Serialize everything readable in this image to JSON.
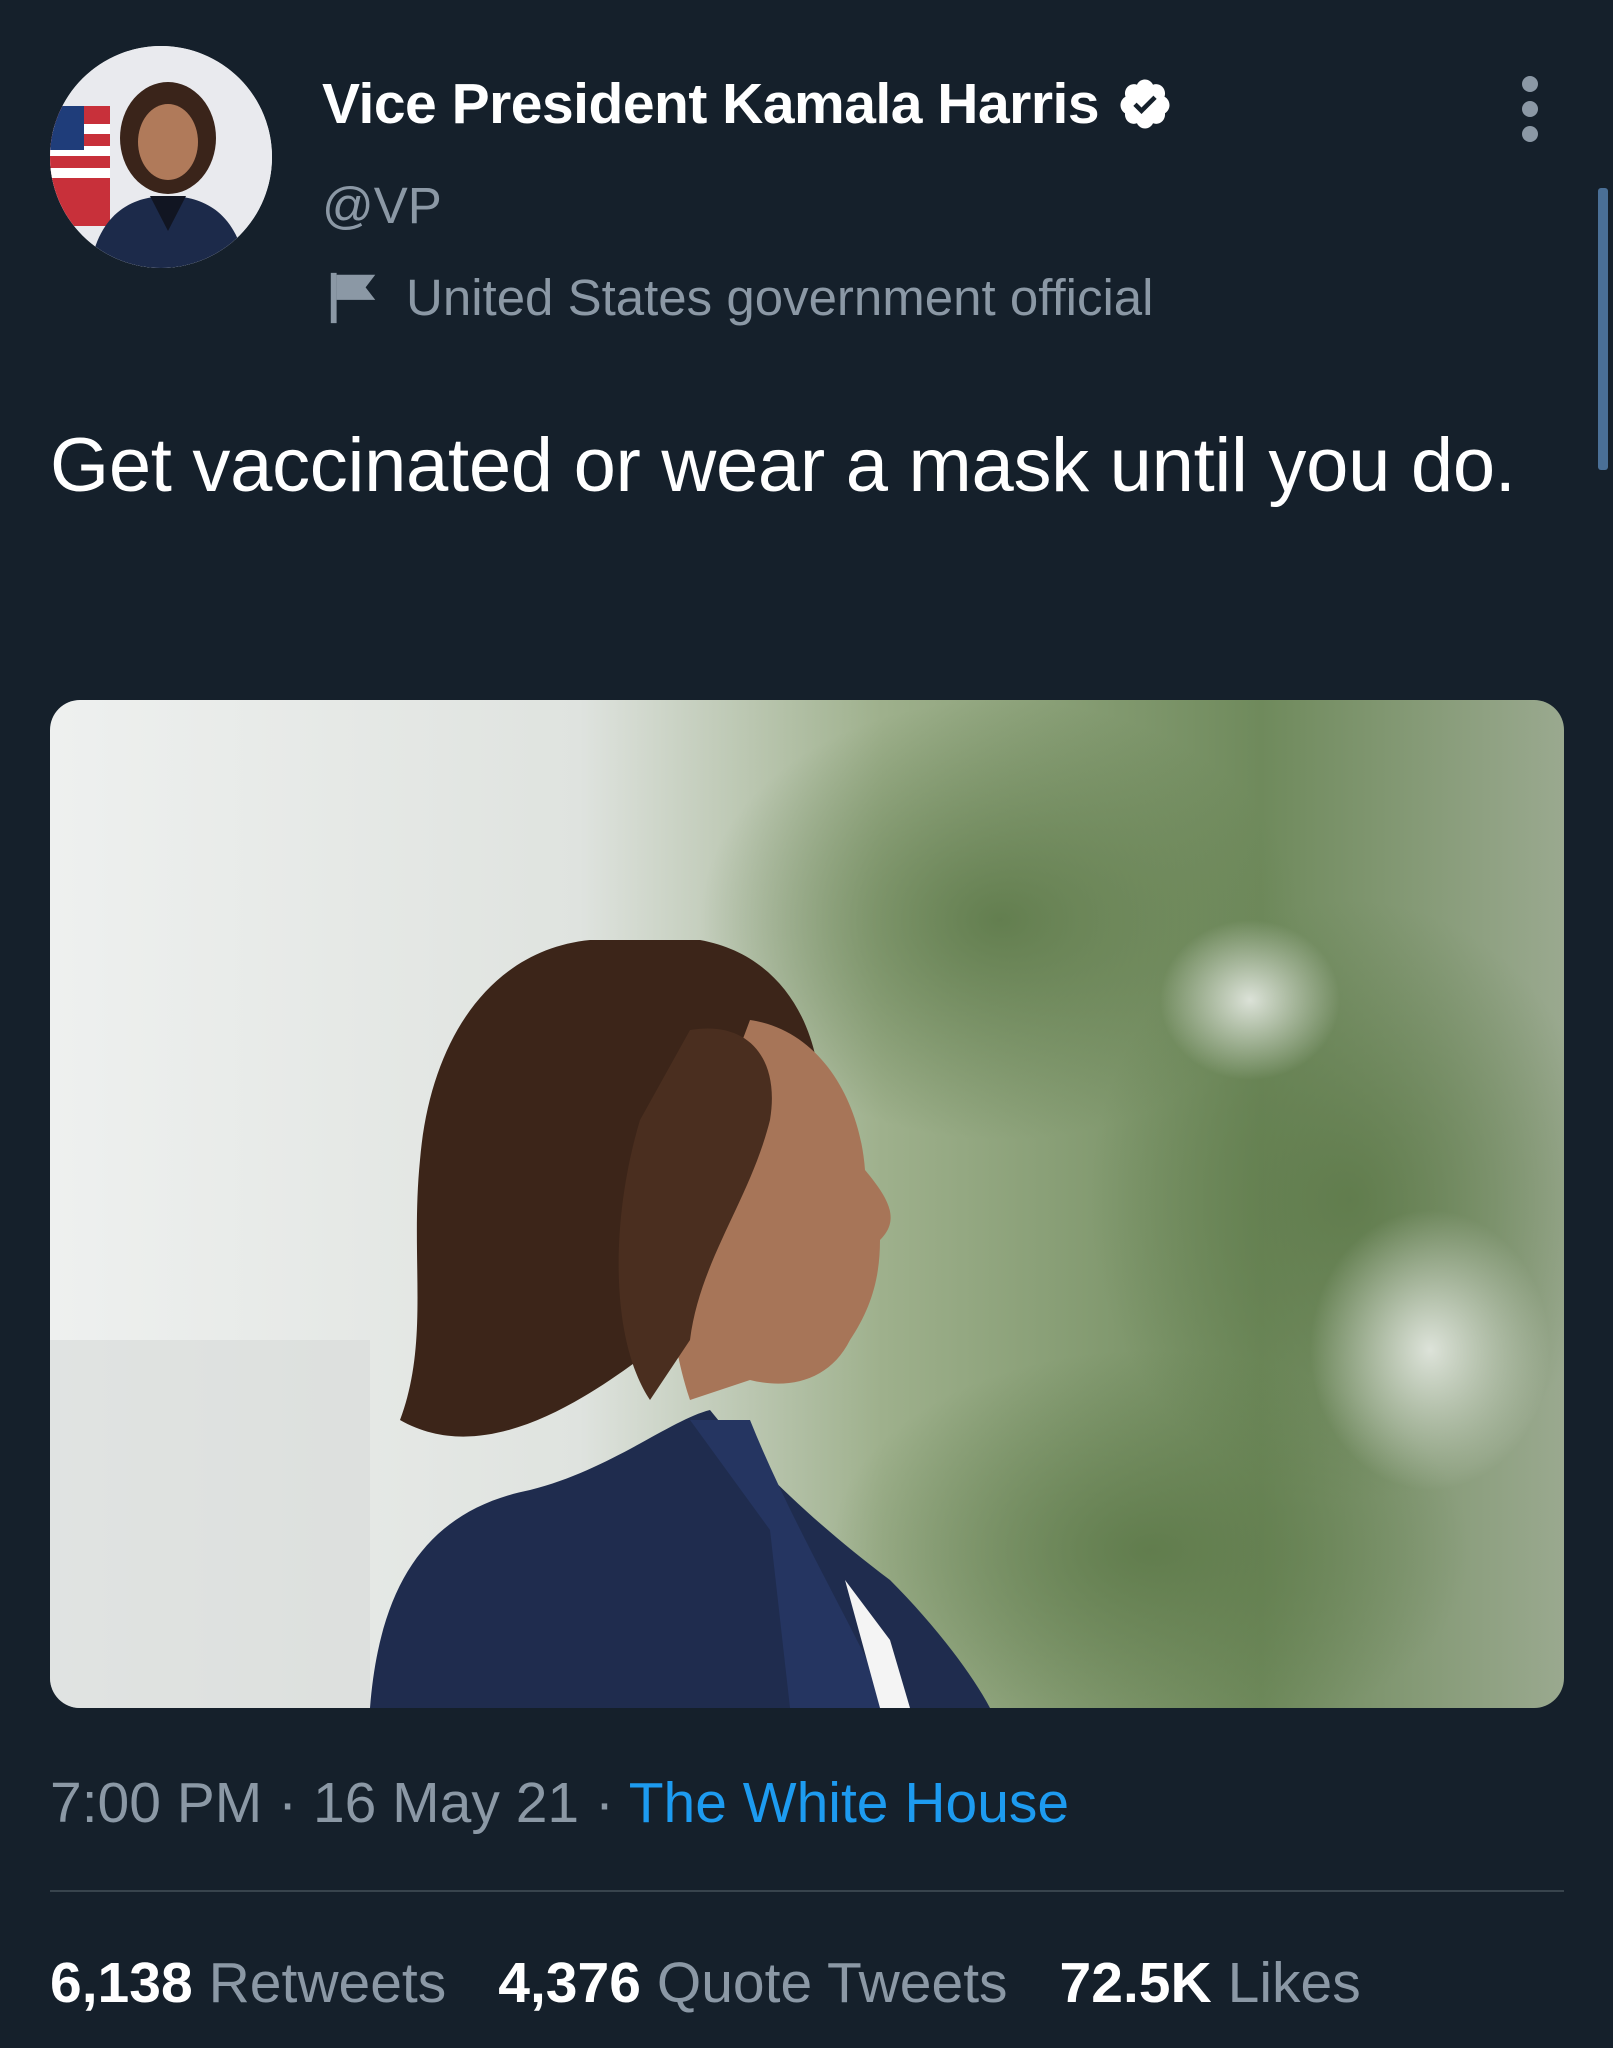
{
  "colors": {
    "background": "#15202b",
    "primary_text": "#ffffff",
    "secondary_text": "#8b98a5",
    "link": "#1d9bf0",
    "divider": "#38444d"
  },
  "author": {
    "display_name": "Vice President Kamala Harris",
    "handle": "@VP",
    "verified": true,
    "account_label": "United States government official",
    "avatar_icon": "profile-avatar",
    "label_icon": "flag-icon"
  },
  "tweet": {
    "text": "Get vaccinated or wear a mask until you do.",
    "media_icon": "photo"
  },
  "meta": {
    "time": "7:00 PM",
    "separator": " · ",
    "date": "16 May 21",
    "source": "The White House"
  },
  "stats": [
    {
      "count": "6,138",
      "label": "Retweets"
    },
    {
      "count": "4,376",
      "label": "Quote Tweets"
    },
    {
      "count": "72.5K",
      "label": "Likes"
    }
  ]
}
